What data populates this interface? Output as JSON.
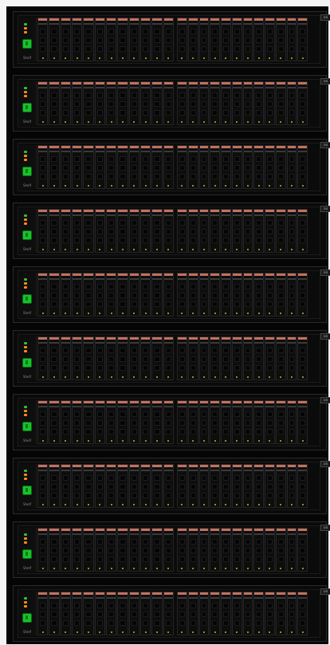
{
  "rack": {
    "shelves": [
      {
        "id": "shelf-1",
        "label": "Shelf",
        "tag": "DS",
        "left_drives": 12,
        "right_drives": 12
      },
      {
        "id": "shelf-2",
        "label": "Shelf",
        "tag": "DS",
        "left_drives": 12,
        "right_drives": 12
      },
      {
        "id": "shelf-3",
        "label": "Shelf",
        "tag": "DS",
        "left_drives": 12,
        "right_drives": 12
      },
      {
        "id": "shelf-4",
        "label": "Shelf",
        "tag": "DS",
        "left_drives": 12,
        "right_drives": 12
      },
      {
        "id": "shelf-5",
        "label": "Shelf",
        "tag": "DS",
        "left_drives": 12,
        "right_drives": 12
      },
      {
        "id": "shelf-6",
        "label": "Shelf",
        "tag": "DS",
        "left_drives": 12,
        "right_drives": 12
      },
      {
        "id": "shelf-7",
        "label": "Shelf",
        "tag": "DS",
        "left_drives": 12,
        "right_drives": 12
      },
      {
        "id": "shelf-8",
        "label": "Shelf",
        "tag": "DS",
        "left_drives": 12,
        "right_drives": 12
      },
      {
        "id": "shelf-9",
        "label": "Shelf",
        "tag": "DS",
        "left_drives": 12,
        "right_drives": 12
      },
      {
        "id": "shelf-10",
        "label": "Shelf",
        "tag": "DS",
        "left_drives": 12,
        "right_drives": 12
      }
    ]
  },
  "colors": {
    "frame": "#050505",
    "drive_top": "#c4705f",
    "status_green": "#1ac12c",
    "status_orange": "#ff8a1a",
    "activity_led": "#8ccf2a"
  },
  "icons": {
    "power": "green-square-icon",
    "activity": "led-dot-icon"
  }
}
